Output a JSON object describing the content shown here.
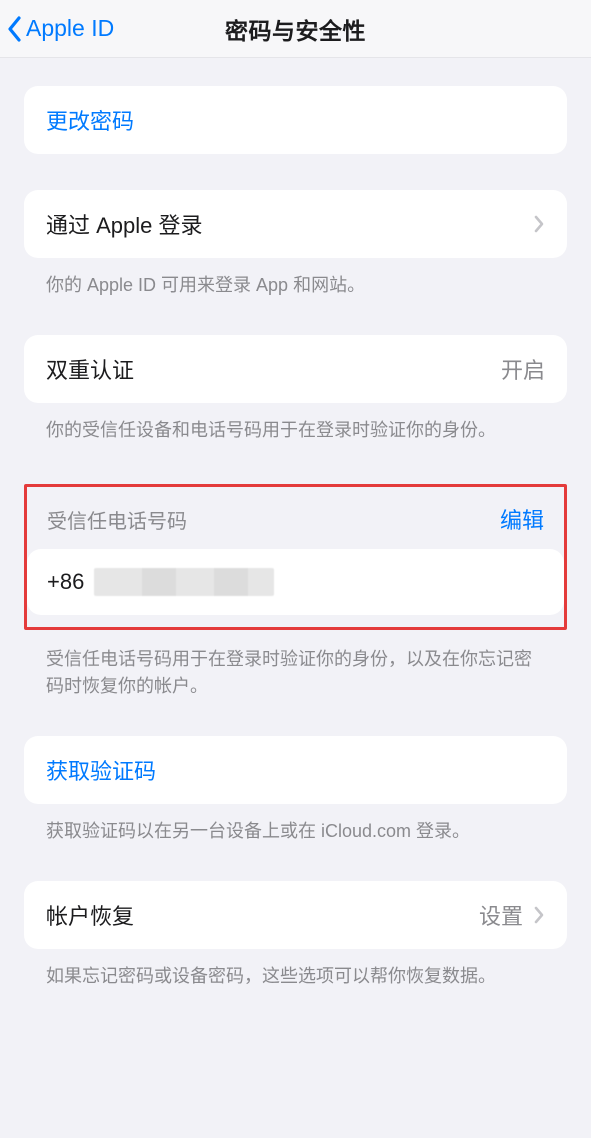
{
  "nav": {
    "back_label": "Apple ID",
    "title": "密码与安全性"
  },
  "change_password": {
    "label": "更改密码"
  },
  "sign_in_with_apple": {
    "label": "通过 Apple 登录",
    "footer": "你的 Apple ID 可用来登录 App 和网站。"
  },
  "two_factor": {
    "label": "双重认证",
    "value": "开启",
    "footer": "你的受信任设备和电话号码用于在登录时验证你的身份。"
  },
  "trusted_phone": {
    "header": "受信任电话号码",
    "edit": "编辑",
    "value_prefix": "+86",
    "footer": "受信任电话号码用于在登录时验证你的身份，以及在你忘记密码时恢复你的帐户。"
  },
  "get_code": {
    "label": "获取验证码",
    "footer": "获取验证码以在另一台设备上或在 iCloud.com 登录。"
  },
  "account_recovery": {
    "label": "帐户恢复",
    "value": "设置",
    "footer": "如果忘记密码或设备密码，这些选项可以帮你恢复数据。"
  }
}
